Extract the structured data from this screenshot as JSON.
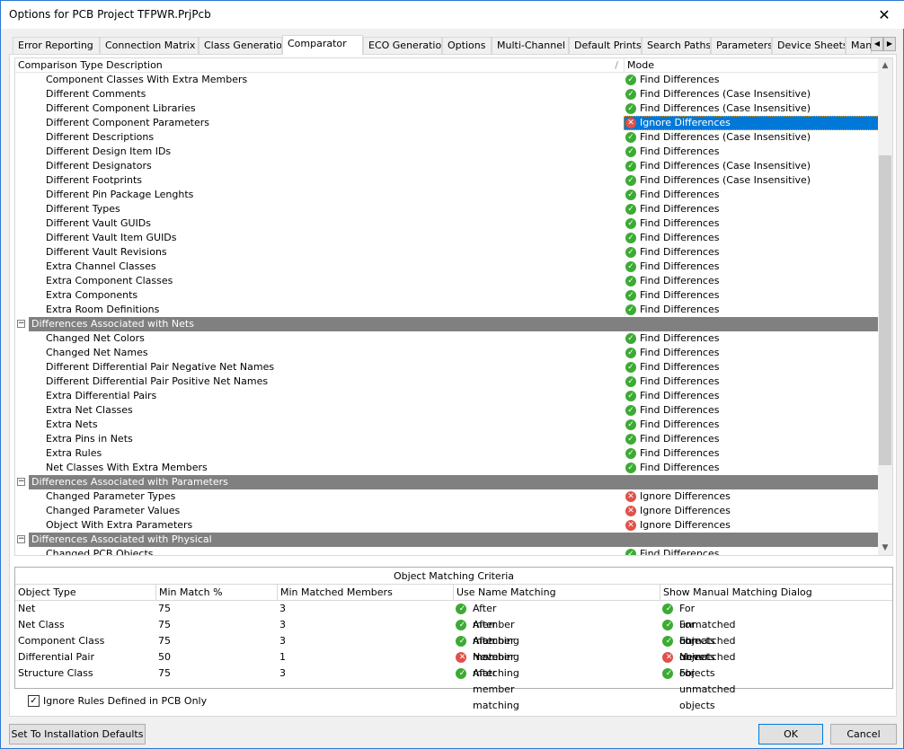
{
  "window": {
    "title": "Options for PCB Project TFPWR.PrjPcb",
    "close": "✕"
  },
  "tabs": [
    "Error Reporting",
    "Connection Matrix",
    "Class Generation",
    "Comparator",
    "ECO Generation",
    "Options",
    "Multi-Channel",
    "Default Prints",
    "Search Paths",
    "Parameters",
    "Device Sheets",
    "Manag"
  ],
  "active_tab": "Comparator",
  "tree": {
    "col_description": "Comparison Type Description",
    "sort_indicator": "/",
    "col_mode": "Mode",
    "rows": [
      {
        "d": "Component Classes With Extra Members",
        "m": "Find Differences",
        "s": "ok"
      },
      {
        "d": "Different Comments",
        "m": "Find Differences (Case Insensitive)",
        "s": "ok"
      },
      {
        "d": "Different Component Libraries",
        "m": "Find Differences (Case Insensitive)",
        "s": "ok"
      },
      {
        "d": "Different Component Parameters",
        "m": "Ignore Differences",
        "s": "no",
        "selected": true
      },
      {
        "d": "Different Descriptions",
        "m": "Find Differences (Case Insensitive)",
        "s": "ok"
      },
      {
        "d": "Different Design Item IDs",
        "m": "Find Differences",
        "s": "ok"
      },
      {
        "d": "Different Designators",
        "m": "Find Differences (Case Insensitive)",
        "s": "ok"
      },
      {
        "d": "Different Footprints",
        "m": "Find Differences (Case Insensitive)",
        "s": "ok"
      },
      {
        "d": "Different Pin Package Lenghts",
        "m": "Find Differences",
        "s": "ok"
      },
      {
        "d": "Different Types",
        "m": "Find Differences",
        "s": "ok"
      },
      {
        "d": "Different Vault GUIDs",
        "m": "Find Differences",
        "s": "ok"
      },
      {
        "d": "Different Vault Item GUIDs",
        "m": "Find Differences",
        "s": "ok"
      },
      {
        "d": "Different Vault Revisions",
        "m": "Find Differences",
        "s": "ok"
      },
      {
        "d": "Extra Channel Classes",
        "m": "Find Differences",
        "s": "ok"
      },
      {
        "d": "Extra Component Classes",
        "m": "Find Differences",
        "s": "ok"
      },
      {
        "d": "Extra Components",
        "m": "Find Differences",
        "s": "ok"
      },
      {
        "d": "Extra Room Definitions",
        "m": "Find Differences",
        "s": "ok"
      },
      {
        "group": "Differences Associated with Nets"
      },
      {
        "d": "Changed Net Colors",
        "m": "Find Differences",
        "s": "ok"
      },
      {
        "d": "Changed Net Names",
        "m": "Find Differences",
        "s": "ok"
      },
      {
        "d": "Different Differential Pair Negative Net Names",
        "m": "Find Differences",
        "s": "ok"
      },
      {
        "d": "Different Differential Pair Positive Net Names",
        "m": "Find Differences",
        "s": "ok"
      },
      {
        "d": "Extra Differential Pairs",
        "m": "Find Differences",
        "s": "ok"
      },
      {
        "d": "Extra Net Classes",
        "m": "Find Differences",
        "s": "ok"
      },
      {
        "d": "Extra Nets",
        "m": "Find Differences",
        "s": "ok"
      },
      {
        "d": "Extra Pins in Nets",
        "m": "Find Differences",
        "s": "ok"
      },
      {
        "d": "Extra Rules",
        "m": "Find Differences",
        "s": "ok"
      },
      {
        "d": "Net Classes With Extra Members",
        "m": "Find Differences",
        "s": "ok"
      },
      {
        "group": "Differences Associated with Parameters"
      },
      {
        "d": "Changed Parameter Types",
        "m": "Ignore Differences",
        "s": "no"
      },
      {
        "d": "Changed Parameter Values",
        "m": "Ignore Differences",
        "s": "no"
      },
      {
        "d": "Object With Extra Parameters",
        "m": "Ignore Differences",
        "s": "no"
      },
      {
        "group": "Differences Associated with Physical"
      },
      {
        "d": "Changed PCB Objects",
        "m": "Find Differences",
        "s": "ok"
      }
    ]
  },
  "matching": {
    "title": "Object Matching Criteria",
    "columns": [
      "Object Type",
      "Min Match %",
      "Min Matched Members",
      "Use Name Matching",
      "Show Manual Matching Dialog"
    ],
    "rows": [
      {
        "type": "Net",
        "min": "75",
        "members": "3",
        "name": "After member matching",
        "name_s": "ok",
        "dialog": "For unmatched objects",
        "dialog_s": "ok"
      },
      {
        "type": "Net Class",
        "min": "75",
        "members": "3",
        "name": "After member matching",
        "name_s": "ok",
        "dialog": "For unmatched objects",
        "dialog_s": "ok"
      },
      {
        "type": "Component Class",
        "min": "75",
        "members": "3",
        "name": "After member matching",
        "name_s": "ok",
        "dialog": "For unmatched objects",
        "dialog_s": "ok"
      },
      {
        "type": "Differential Pair",
        "min": "50",
        "members": "1",
        "name": "Never",
        "name_s": "no",
        "dialog": "Never",
        "dialog_s": "no"
      },
      {
        "type": "Structure Class",
        "min": "75",
        "members": "3",
        "name": "After member matching",
        "name_s": "ok",
        "dialog": "For unmatched objects",
        "dialog_s": "ok"
      }
    ]
  },
  "ignore_rules": {
    "label": "Ignore Rules Defined in PCB Only",
    "checked": true
  },
  "buttons": {
    "defaults": "Set To Installation Defaults",
    "ok": "OK",
    "cancel": "Cancel"
  },
  "colors": {
    "accent": "#0078d7",
    "group_bg": "#808080",
    "ok": "#3cab34",
    "no": "#e0514a"
  }
}
